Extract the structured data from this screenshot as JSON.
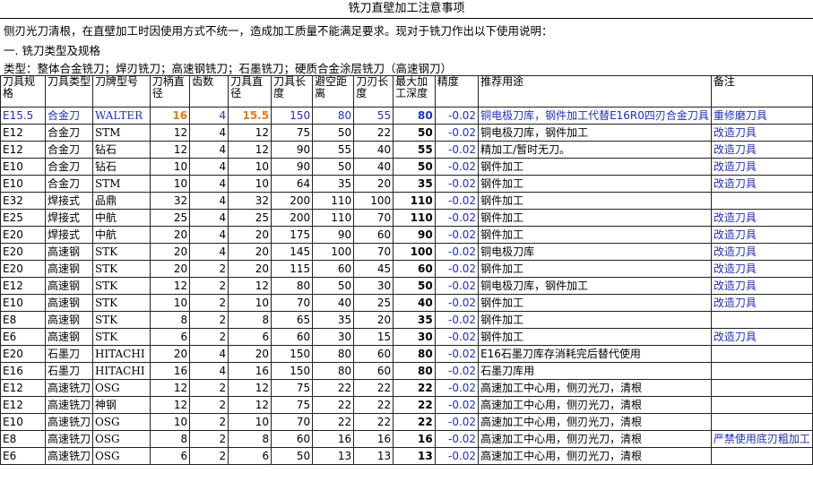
{
  "title": "铣刀直壁加工注意事项",
  "intro": "侧刃光刀清根，在直壁加工时因使用方式不统一，造成加工质量不能满足要求。现对于铣刀作出以下使用说明：",
  "section1": "一. 铣刀类型及规格",
  "types_line": "类型：整体合金铣刀；焊刃铣刀；高速钢铣刀；石墨铣刀；硬质合金涂层铣刀（高速钢刀）",
  "table": {
    "headers": [
      "刀具规格",
      "刀具类型",
      "刀牌型号",
      "刀柄直径",
      "齿数",
      "刀具直径",
      "刀具长度",
      "避空距离",
      "刀刃长度",
      "最大加工深度",
      "精度",
      "推荐用途",
      "备注"
    ],
    "rows": [
      [
        "E15.5",
        "合金刀",
        "WALTER",
        "16",
        "4",
        "15.5",
        "150",
        "80",
        "55",
        "80",
        "-0.02",
        "铜电极刀库，钢件加工代替E16R0四刃合金刀具",
        "重修磨刀具"
      ],
      [
        "E12",
        "合金刀",
        "STM",
        "12",
        "4",
        "12",
        "75",
        "50",
        "22",
        "50",
        "-0.02",
        "铜电极刀库，钢件加工",
        "改造刀具"
      ],
      [
        "E12",
        "合金刀",
        "钻石",
        "12",
        "4",
        "12",
        "90",
        "55",
        "40",
        "55",
        "-0.02",
        "精加工/暂时无刀。",
        "改造刀具"
      ],
      [
        "E10",
        "合金刀",
        "钻石",
        "10",
        "4",
        "10",
        "90",
        "50",
        "40",
        "50",
        "-0.02",
        "钢件加工",
        "改造刀具"
      ],
      [
        "E10",
        "合金刀",
        "STM",
        "10",
        "4",
        "10",
        "64",
        "35",
        "20",
        "35",
        "-0.02",
        "钢件加工",
        "改造刀具"
      ],
      [
        "E32",
        "焊接式",
        "品鼎",
        "32",
        "4",
        "32",
        "200",
        "110",
        "100",
        "110",
        "-0.02",
        "钢件加工",
        ""
      ],
      [
        "E25",
        "焊接式",
        "中航",
        "25",
        "4",
        "25",
        "200",
        "110",
        "70",
        "110",
        "-0.02",
        "钢件加工",
        "改造刀具"
      ],
      [
        "E20",
        "焊接式",
        "中航",
        "20",
        "4",
        "20",
        "175",
        "90",
        "60",
        "90",
        "-0.02",
        "钢件加工",
        "改造刀具"
      ],
      [
        "E20",
        "高速钢",
        "STK",
        "20",
        "4",
        "20",
        "145",
        "100",
        "70",
        "100",
        "-0.02",
        "铜电极刀库",
        "改造刀具"
      ],
      [
        "E20",
        "高速钢",
        "STK",
        "20",
        "2",
        "20",
        "115",
        "60",
        "45",
        "60",
        "-0.02",
        "钢件加工",
        "改造刀具"
      ],
      [
        "E12",
        "高速钢",
        "STK",
        "12",
        "2",
        "12",
        "80",
        "50",
        "30",
        "50",
        "-0.02",
        "铜电极刀库，钢件加工",
        "改造刀具"
      ],
      [
        "E10",
        "高速钢",
        "STK",
        "10",
        "2",
        "10",
        "70",
        "40",
        "25",
        "40",
        "-0.02",
        "钢件加工",
        "改造刀具"
      ],
      [
        "E8",
        "高速钢",
        "STK",
        "8",
        "2",
        "8",
        "65",
        "35",
        "20",
        "35",
        "-0.02",
        "钢件加工",
        ""
      ],
      [
        "E6",
        "高速钢",
        "STK",
        "6",
        "2",
        "6",
        "60",
        "30",
        "15",
        "30",
        "-0.02",
        "钢件加工",
        "改造刀具"
      ],
      [
        "E20",
        "石墨刀",
        "HITACHI",
        "20",
        "4",
        "20",
        "150",
        "80",
        "60",
        "80",
        "-0.02",
        "E16石墨刀库存消耗完后替代使用",
        ""
      ],
      [
        "E16",
        "石墨刀",
        "HITACHI",
        "16",
        "4",
        "16",
        "150",
        "80",
        "60",
        "80",
        "-0.02",
        "石墨刀库用",
        ""
      ],
      [
        "E12",
        "高速铣刀",
        "OSG",
        "12",
        "2",
        "12",
        "75",
        "22",
        "22",
        "22",
        "-0.02",
        "高速加工中心用，侧刃光刀，清根",
        ""
      ],
      [
        "E12",
        "高速铣刀",
        "神钢",
        "12",
        "2",
        "12",
        "75",
        "22",
        "22",
        "22",
        "-0.02",
        "高速加工中心用，侧刃光刀，清根",
        ""
      ],
      [
        "E10",
        "高速铣刀",
        "OSG",
        "10",
        "2",
        "10",
        "70",
        "22",
        "22",
        "22",
        "-0.02",
        "高速加工中心用，侧刃光刀，清根",
        ""
      ],
      [
        "E8",
        "高速铣刀",
        "OSG",
        "8",
        "2",
        "8",
        "60",
        "16",
        "16",
        "16",
        "-0.02",
        "高速加工中心用，侧刃光刀，清根",
        "严禁使用底刃粗加工"
      ],
      [
        "E6",
        "高速铣刀",
        "OSG",
        "6",
        "2",
        "6",
        "50",
        "13",
        "13",
        "13",
        "-0.02",
        "高速加工中心用，侧刃光刀，清根",
        ""
      ]
    ]
  },
  "colors": {
    "link_blue": "#1f2fbf",
    "highlight_orange": "#e07a1a"
  }
}
